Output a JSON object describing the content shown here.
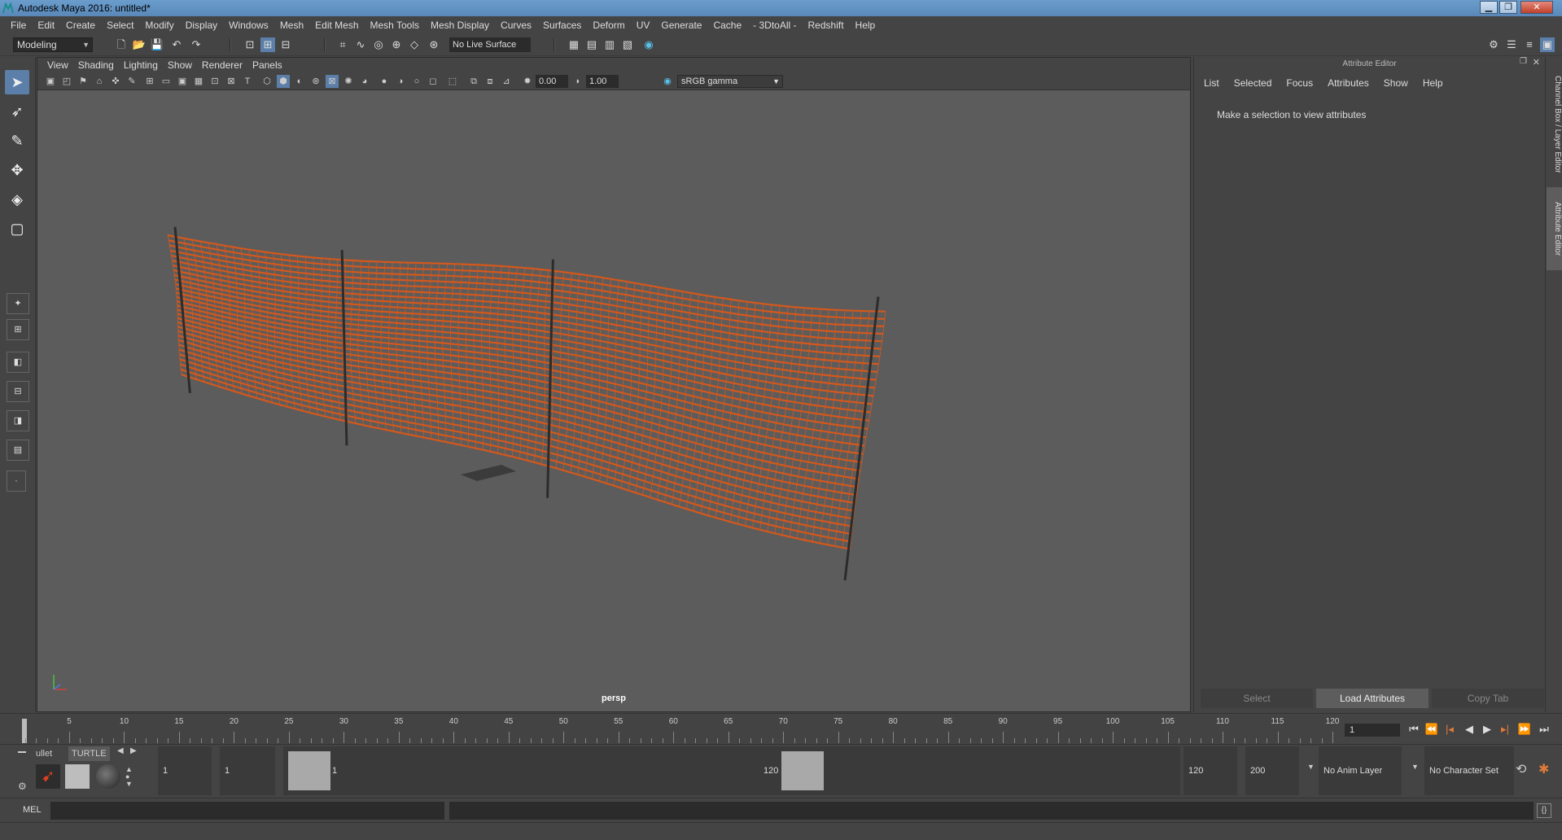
{
  "window": {
    "title": "Autodesk Maya 2016: untitled*"
  },
  "menu": [
    "File",
    "Edit",
    "Create",
    "Select",
    "Modify",
    "Display",
    "Windows",
    "Mesh",
    "Edit Mesh",
    "Mesh Tools",
    "Mesh Display",
    "Curves",
    "Surfaces",
    "Deform",
    "UV",
    "Generate",
    "Cache",
    "- 3DtoAll -",
    "Redshift",
    "Help"
  ],
  "status": {
    "mode": "Modeling",
    "live_surface": "No Live Surface"
  },
  "viewport": {
    "menu": [
      "View",
      "Shading",
      "Lighting",
      "Show",
      "Renderer",
      "Panels"
    ],
    "exposure": "0.00",
    "gamma_value": "1.00",
    "color_space": "sRGB gamma",
    "camera_label": "persp"
  },
  "attribute_editor": {
    "header": "Attribute Editor",
    "tabs": [
      "List",
      "Selected",
      "Focus",
      "Attributes",
      "Show",
      "Help"
    ],
    "message": "Make a selection to view attributes",
    "buttons": {
      "select": "Select",
      "load": "Load Attributes",
      "copy": "Copy Tab"
    }
  },
  "side_tabs": {
    "channel_box": "Channel Box / Layer Editor",
    "attribute_editor": "Attribute Editor"
  },
  "timeline": {
    "start_label": "1",
    "ticks": [
      "5",
      "10",
      "15",
      "20",
      "25",
      "30",
      "35",
      "40",
      "45",
      "50",
      "55",
      "60",
      "65",
      "70",
      "75",
      "80",
      "85",
      "90",
      "95",
      "100",
      "105",
      "110",
      "115",
      "120"
    ],
    "current_frame": "1"
  },
  "shelf": {
    "tabs": [
      "ullet",
      "TURTLE"
    ]
  },
  "range": {
    "start": "1",
    "playback_start": "1",
    "slider_start": "1",
    "slider_end": "120",
    "playback_end": "120",
    "end": "200",
    "anim_layer": "No Anim Layer",
    "character_set": "No Character Set"
  },
  "command": {
    "label": "MEL"
  },
  "colors": {
    "fence": "#d4581c",
    "viewport_bg": "#5c5c5c",
    "panel_bg": "#444444",
    "accent": "#5b7fa8"
  }
}
